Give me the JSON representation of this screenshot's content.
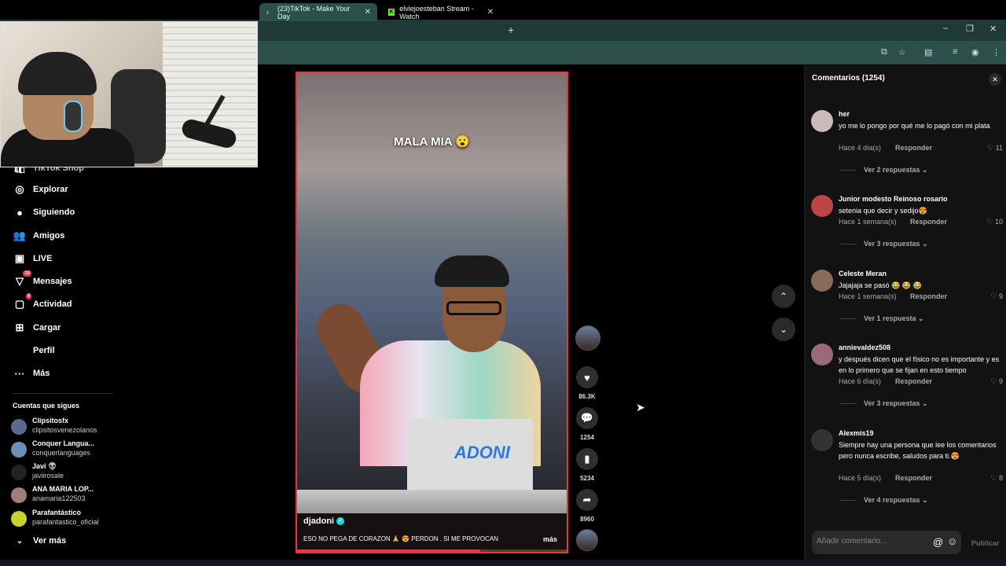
{
  "browser": {
    "tabs": [
      {
        "label": "(23)TikTok - Make Your Day",
        "active": true
      },
      {
        "label": "elviejoesteban Stream - Watch",
        "active": false
      }
    ],
    "new_tab": "+",
    "controls": {
      "minimize": "–",
      "restore": "❐",
      "close": "✕"
    }
  },
  "sidebar": {
    "partial_item": "TikTok Shop",
    "items": [
      {
        "label": "Explorar",
        "icon": "compass-icon",
        "glyph": "◎"
      },
      {
        "label": "Siguiendo",
        "icon": "following-icon",
        "glyph": "●"
      },
      {
        "label": "Amigos",
        "icon": "friends-icon",
        "glyph": "👥"
      },
      {
        "label": "LIVE",
        "icon": "live-icon",
        "glyph": "▣"
      },
      {
        "label": "Mensajes",
        "icon": "messages-icon",
        "glyph": "▽",
        "badge": "19"
      },
      {
        "label": "Actividad",
        "icon": "activity-icon",
        "glyph": "▢",
        "badge": "4"
      },
      {
        "label": "Cargar",
        "icon": "upload-icon",
        "glyph": "⊞"
      },
      {
        "label": "Perfil",
        "icon": "profile-icon",
        "glyph": ""
      },
      {
        "label": "Más",
        "icon": "more-icon",
        "glyph": "···"
      }
    ],
    "following_title": "Cuentas que sigues",
    "accounts": [
      {
        "name": "Clipsitosfx",
        "handle": "clipsitosvenezolanos",
        "color": "#5a6a8a"
      },
      {
        "name": "Conquer Langua...",
        "handle": "conquerlanguages",
        "color": "#6c8fb5"
      },
      {
        "name": "Javi 👽",
        "handle": "javiirosale",
        "color": "#222"
      },
      {
        "name": "ANA MARIA LOP...",
        "handle": "anamaria122503",
        "color": "#a07d7a"
      },
      {
        "name": "Parafantástico",
        "handle": "parafantastico_oficial",
        "color": "#c9d42a"
      }
    ],
    "see_more": "Ver más"
  },
  "video": {
    "caption": "MALA MIA 😮",
    "username": "djadoni",
    "description": "ESO NO PEGA DE CORAZON 🙏 😍 PERDON . SI ME PROVOCAN",
    "more": "más",
    "progress": 0.68
  },
  "actions": {
    "likes": "86.3K",
    "comments": "1254",
    "saves": "5234",
    "shares": "8960"
  },
  "comments": {
    "title": "Comentarios",
    "count": "(1254)",
    "reply_label": "Responder",
    "items": [
      {
        "user": "her",
        "text": "yo me lo pongo por qué me lo pagó con mi plata",
        "time": "Hace 4 día(s)",
        "likes": "11",
        "more": "Ver 2 respuestas ⌄",
        "color": "#cbb"
      },
      {
        "user": "Junior modesto Reinoso rosario",
        "text": "setenia que decir y sedijo😍",
        "time": "Hace 1 semana(s)",
        "likes": "10",
        "more": "Ver 3 respuestas ⌄",
        "color": "#b44"
      },
      {
        "user": "Celeste Meran",
        "text": "Jajajaja se pasó 😂 😂 😂",
        "time": "Hace 1 semana(s)",
        "likes": "9",
        "more": "Ver 1 respuesta ⌄",
        "color": "#8a6a5a"
      },
      {
        "user": "annievaldez508",
        "text": "y después dicen que el físico no es importante y es en lo primero que se fijan en esto tiempo",
        "time": "Hace 6 día(s)",
        "likes": "9",
        "more": "Ver 3 respuestas ⌄",
        "color": "#9a6a7a"
      },
      {
        "user": "Alexmis19",
        "text": "Siempre hay una persona que lee los comentarios pero nunca escribe, saludos para ti.😍",
        "time": "Hace 5 día(s)",
        "likes": "8",
        "more": "Ver 4 respuestas ⌄",
        "color": "#333"
      }
    ],
    "input_placeholder": "Añadir comentario...",
    "post_label": "Publicar"
  }
}
